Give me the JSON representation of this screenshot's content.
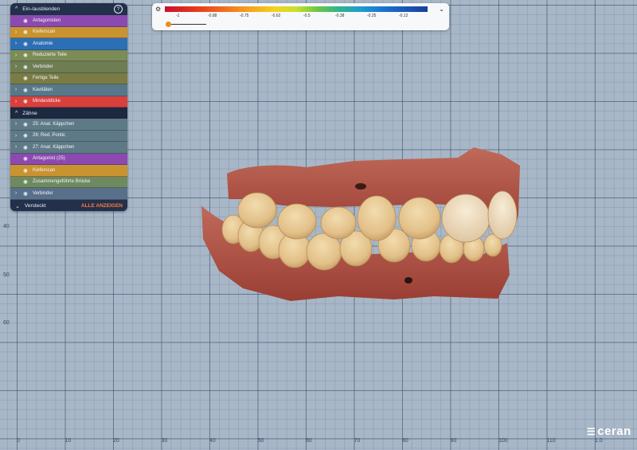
{
  "panel": {
    "header": "Ein-/ausblenden",
    "help_icon": "?",
    "items": [
      {
        "label": "Antagonisten",
        "arrow": "",
        "color": "#8c4ab0"
      },
      {
        "label": "Kieferscan",
        "arrow": "›",
        "color": "#c9932f"
      },
      {
        "label": "Anatomie",
        "arrow": "›",
        "color": "#2d6fb5"
      },
      {
        "label": "Reduzierte Teile",
        "arrow": "›",
        "color": "#7b8c55"
      },
      {
        "label": "Verbinder",
        "arrow": "›",
        "color": "#6e7d52"
      },
      {
        "label": "Fertige Teile",
        "arrow": "",
        "color": "#7a7c45"
      },
      {
        "label": "Kavitäten",
        "arrow": "›",
        "color": "#58788a"
      },
      {
        "label": "Mindestdicke",
        "arrow": "›",
        "color": "#d9403c"
      }
    ],
    "section": "Zähne",
    "teeth_items": [
      {
        "label": "25: Anat. Käppchen",
        "arrow": "›",
        "color": "#5e7a86"
      },
      {
        "label": "26: Red. Pontic",
        "arrow": "›",
        "color": "#5e7a86"
      },
      {
        "label": "27: Anat. Käppchen",
        "arrow": "›",
        "color": "#5e7a86"
      },
      {
        "label": "Antagonist (25)",
        "arrow": "",
        "color": "#8c4ab0"
      },
      {
        "label": "Kieferscan",
        "arrow": "",
        "color": "#c9932f"
      },
      {
        "label": "Zusammengeführte Brücke",
        "arrow": "",
        "color": "#6e8a60"
      },
      {
        "label": "Verbinder",
        "arrow": "›",
        "color": "#59708a"
      }
    ],
    "footer_label": "Versteckt",
    "footer_action": "ALLE ANZEIGEN"
  },
  "scale": {
    "ticks": [
      "-1",
      "-0.88",
      "-0.75",
      "-0.62",
      "-0.5",
      "-0.38",
      "-0.25",
      "-0.12"
    ]
  },
  "ruler": {
    "x": [
      "0",
      "10",
      "20",
      "30",
      "40",
      "50",
      "60",
      "70",
      "80",
      "90",
      "100",
      "110",
      "1.0"
    ],
    "y": [
      "40",
      "50",
      "60"
    ]
  },
  "logo": {
    "text": "ceran"
  }
}
